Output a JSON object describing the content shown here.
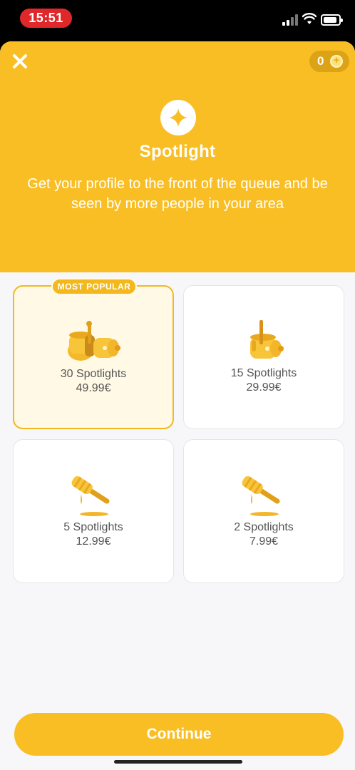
{
  "status_bar": {
    "time": "15:51"
  },
  "header": {
    "coin_count": "0",
    "title": "Spotlight",
    "subtitle": "Get your profile to the front of the queue and be seen by more people in your area"
  },
  "packages": [
    {
      "badge": "MOST POPULAR",
      "name": "30 Spotlights",
      "price": "49.99€",
      "selected": true,
      "icon": "honey-jars-large-icon"
    },
    {
      "name": "15 Spotlights",
      "price": "29.99€",
      "selected": false,
      "icon": "honey-jar-icon"
    },
    {
      "name": "5 Spotlights",
      "price": "12.99€",
      "selected": false,
      "icon": "honey-dipper-icon"
    },
    {
      "name": "2 Spotlights",
      "price": "7.99€",
      "selected": false,
      "icon": "honey-dipper-small-icon"
    }
  ],
  "footer": {
    "continue_label": "Continue"
  },
  "colors": {
    "accent": "#f8be24",
    "selected_bg": "#fff9e6",
    "status_time_bg": "#e0282b"
  }
}
